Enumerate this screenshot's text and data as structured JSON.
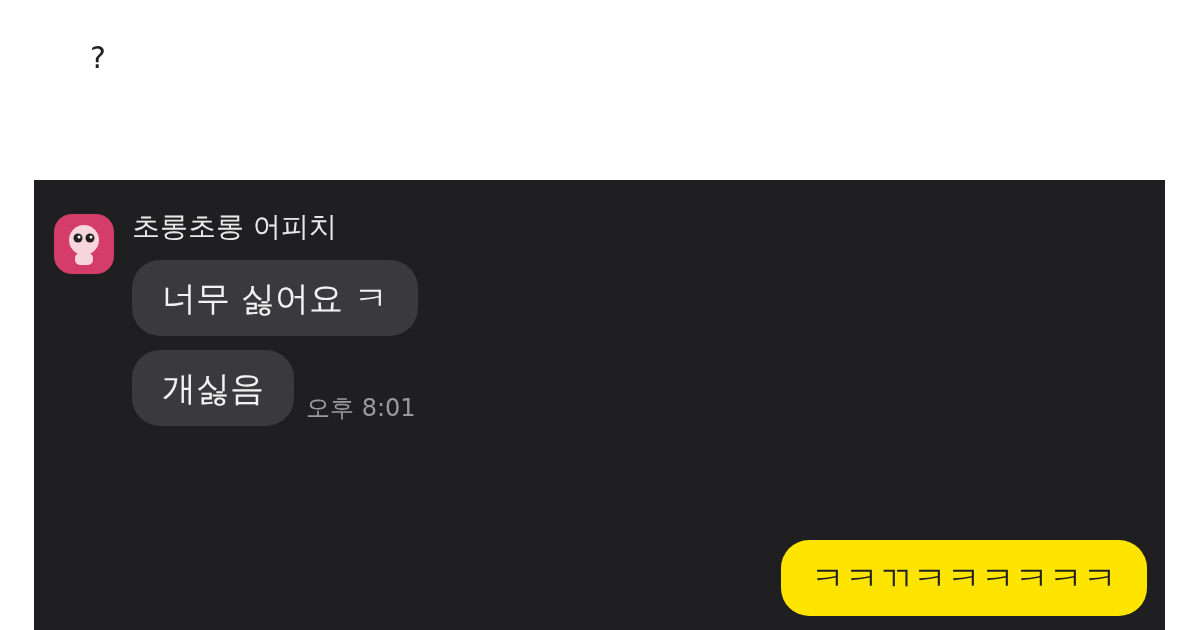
{
  "question_mark": "?",
  "chat": {
    "received": {
      "sender": "초롱초롱 어피치",
      "bubbles": [
        "너무 싫어요 ㅋ",
        "개싫음"
      ],
      "time": "오후 8:01"
    },
    "sent": {
      "bubbles": [
        "ㅋㅋㄲㅋㅋㅋㅋㅋㅋ"
      ]
    }
  }
}
